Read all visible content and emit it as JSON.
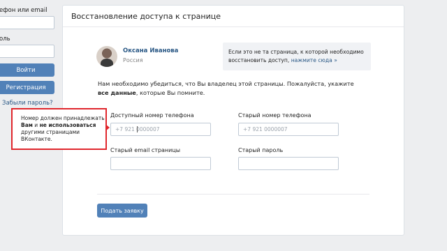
{
  "login": {
    "phone_label": "ефон или email",
    "password_label": "оль",
    "login_button": "Войти",
    "register_button": "Регистрация",
    "forgot_link": "Забыли пароль?"
  },
  "card": {
    "title": "Восстановление доступа к странице"
  },
  "profile": {
    "name": "Оксана Иванова",
    "country": "Россия"
  },
  "notice": {
    "text": "Если это не та страница, к которой необходимо восстановить доступ,",
    "link": "нажмите сюда »"
  },
  "description": {
    "part1": "Нам необходимо убедиться, что Вы владелец этой страницы. Пожалуйста, укажите ",
    "bold": "все данные",
    "part2": ", которые Вы помните."
  },
  "form": {
    "available_phone_label": "Доступный номер телефона",
    "available_phone_placeholder": "+7 921 0000007",
    "old_phone_label": "Старый номер телефона",
    "old_phone_placeholder": "+7 921 0000007",
    "old_email_label": "Старый email страницы",
    "old_password_label": "Старый пароль",
    "submit_button": "Подать заявку"
  },
  "tooltip": {
    "line1": "Номер должен принадлежать",
    "bold1": "Вам",
    "mid": " и ",
    "bold2": "не использоваться",
    "line3": "другими страницами ВКонтакте."
  },
  "colors": {
    "accent": "#5181b8",
    "link": "#2a5885",
    "highlight": "#e0262c",
    "background": "#edeef0"
  }
}
